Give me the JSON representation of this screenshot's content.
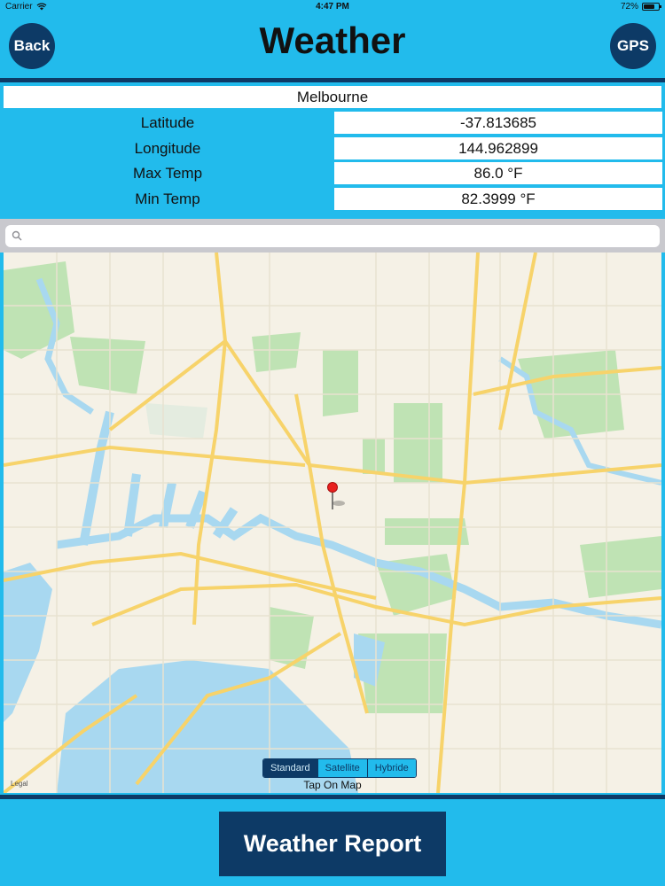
{
  "status_bar": {
    "carrier": "Carrier",
    "time": "4:47 PM",
    "battery": "72%",
    "battery_level": 0.72
  },
  "header": {
    "title": "Weather",
    "back_label": "Back",
    "gps_label": "GPS"
  },
  "location": {
    "city": "Melbourne",
    "rows": [
      {
        "label": "Latitude",
        "value": "-37.813685"
      },
      {
        "label": "Longitude",
        "value": "144.962899"
      },
      {
        "label": "Max Temp",
        "value": "86.0 °F"
      },
      {
        "label": "Min Temp",
        "value": "82.3999 °F"
      }
    ]
  },
  "search": {
    "placeholder": ""
  },
  "map": {
    "legal": "Legal",
    "map_types": [
      "Standard",
      "Satellite",
      "Hybride"
    ],
    "selected_type": "Standard",
    "hint": "Tap On Map"
  },
  "footer": {
    "report_label": "Weather Report"
  },
  "colors": {
    "background": "#22bbec",
    "accent": "#0d3a66",
    "water": "#a8d8f0",
    "park": "#bfe3b4",
    "road": "#f7d36a"
  }
}
